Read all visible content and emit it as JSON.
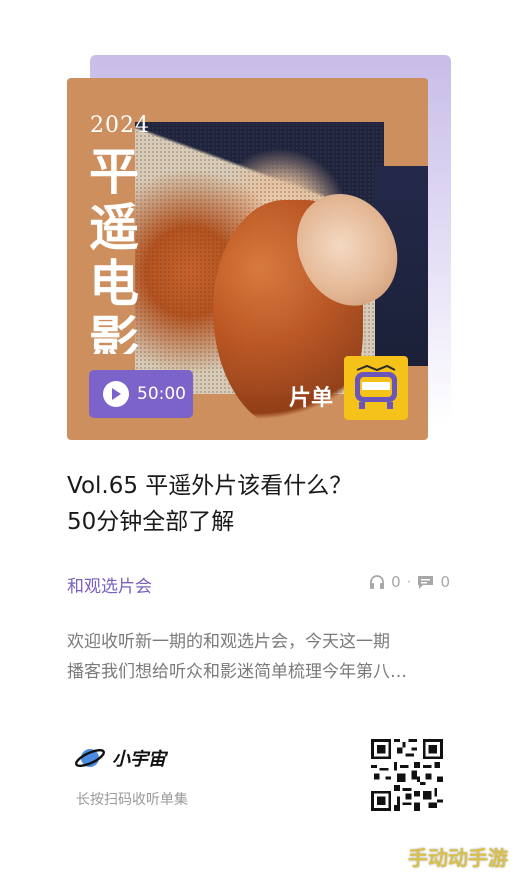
{
  "cover": {
    "year": "2024",
    "vertical_title": "平遥电影展",
    "duration": "50:00",
    "pian_label": "片单",
    "badge_icon": "tv-icon",
    "accent": "#7b63c9",
    "bg_color": "#cc8f5d"
  },
  "episode": {
    "title_line1": "Vol.65  平遥外片该看什么？",
    "title_line2": "50分钟全部了解",
    "channel": "和观选片会",
    "listens": "0",
    "comments": "0",
    "description_line1": "欢迎收听新一期的和观选片会，今天这一期",
    "description_line2": "播客我们想给听众和影迷简单梳理今年第八…"
  },
  "footer": {
    "brand_name": "小宇宙",
    "hint": "长按扫码收听单集"
  },
  "watermark": "手动动手游"
}
